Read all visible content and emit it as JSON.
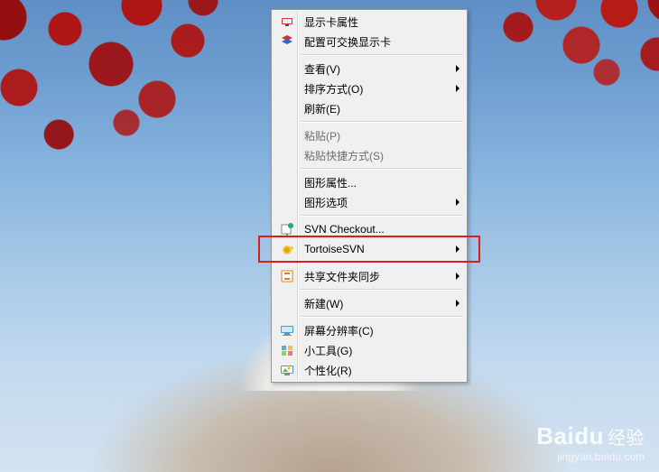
{
  "watermark": {
    "logo_main": "Baidu",
    "logo_sub": "经验",
    "url": "jingyan.baidu.com"
  },
  "context_menu": {
    "groups": [
      [
        {
          "id": "gpu-props",
          "label": "显示卡属性",
          "icon": "gpu-icon",
          "submenu": false,
          "disabled": false
        },
        {
          "id": "switchable-gpu",
          "label": "配置可交换显示卡",
          "icon": "gpu-switch-icon",
          "submenu": false,
          "disabled": false
        }
      ],
      [
        {
          "id": "view",
          "label": "查看(V)",
          "icon": null,
          "submenu": true,
          "disabled": false
        },
        {
          "id": "sort",
          "label": "排序方式(O)",
          "icon": null,
          "submenu": true,
          "disabled": false
        },
        {
          "id": "refresh",
          "label": "刷新(E)",
          "icon": null,
          "submenu": false,
          "disabled": false
        }
      ],
      [
        {
          "id": "paste",
          "label": "粘贴(P)",
          "icon": null,
          "submenu": false,
          "disabled": true
        },
        {
          "id": "paste-shortcut",
          "label": "粘贴快捷方式(S)",
          "icon": null,
          "submenu": false,
          "disabled": true
        }
      ],
      [
        {
          "id": "graphics-props",
          "label": "图形属性...",
          "icon": null,
          "submenu": false,
          "disabled": false
        },
        {
          "id": "graphics-options",
          "label": "图形选项",
          "icon": null,
          "submenu": true,
          "disabled": false
        }
      ],
      [
        {
          "id": "svn-checkout",
          "label": "SVN Checkout...",
          "icon": "svn-checkout-icon",
          "submenu": false,
          "disabled": false
        },
        {
          "id": "tortoisesvn",
          "label": "TortoiseSVN",
          "icon": "tortoise-icon",
          "submenu": true,
          "disabled": false,
          "highlighted": true
        }
      ],
      [
        {
          "id": "share-sync",
          "label": "共享文件夹同步",
          "icon": "share-sync-icon",
          "submenu": true,
          "disabled": false
        }
      ],
      [
        {
          "id": "new",
          "label": "新建(W)",
          "icon": null,
          "submenu": true,
          "disabled": false
        }
      ],
      [
        {
          "id": "screen-res",
          "label": "屏幕分辨率(C)",
          "icon": "monitor-icon",
          "submenu": false,
          "disabled": false
        },
        {
          "id": "gadgets",
          "label": "小工具(G)",
          "icon": "gadgets-icon",
          "submenu": false,
          "disabled": false
        },
        {
          "id": "personalize",
          "label": "个性化(R)",
          "icon": "personalize-icon",
          "submenu": false,
          "disabled": false
        }
      ]
    ]
  },
  "highlight_color": "#e11b1b"
}
